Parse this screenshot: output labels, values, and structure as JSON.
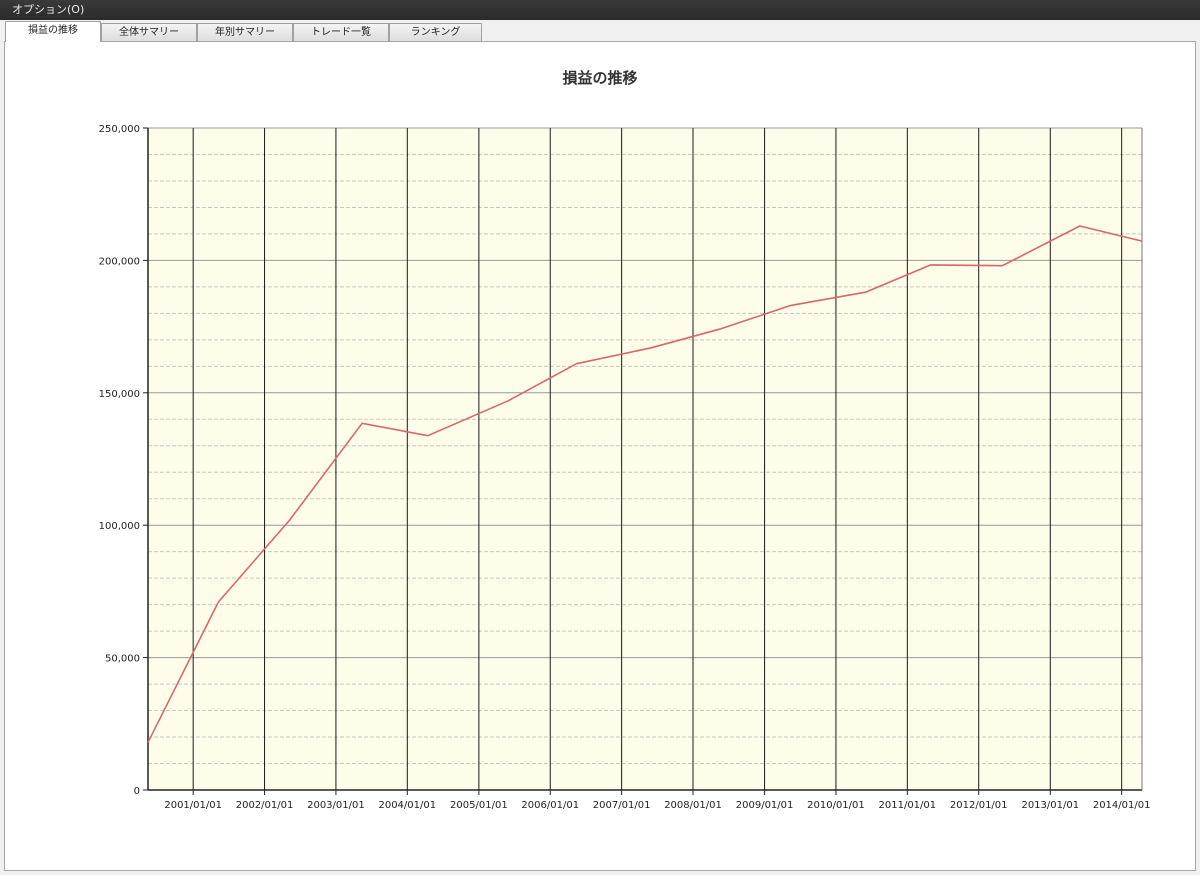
{
  "menubar": {
    "options_label": "オプション(O)"
  },
  "tabs": [
    {
      "label": "損益の推移",
      "active": true
    },
    {
      "label": "全体サマリー",
      "active": false
    },
    {
      "label": "年別サマリー",
      "active": false
    },
    {
      "label": "トレード一覧",
      "active": false
    },
    {
      "label": "ランキング",
      "active": false
    }
  ],
  "colors": {
    "plot_background": "#fdfdea",
    "major_grid": "#1a1a1a",
    "minor_grid": "#c8c8c0",
    "line": "#d8676a"
  },
  "chart_data": {
    "type": "line",
    "title": "損益の推移",
    "xlabel": "",
    "ylabel": "",
    "grid": true,
    "x_ticks": [
      "2001/01/01",
      "2002/01/01",
      "2003/01/01",
      "2004/01/01",
      "2005/01/01",
      "2006/01/01",
      "2007/01/01",
      "2008/01/01",
      "2009/01/01",
      "2010/01/01",
      "2011/01/01",
      "2012/01/01",
      "2013/01/01",
      "2014/01/01"
    ],
    "xlim": [
      "2000/05/15",
      "2014/04/15"
    ],
    "y_ticks": [
      "0",
      "50,000",
      "100,000",
      "150,000",
      "200,000",
      "250,000"
    ],
    "ylim": [
      0,
      250000
    ],
    "series": [
      {
        "name": "",
        "x": [
          "2000/05/15",
          "2001/05/10",
          "2002/05/10",
          "2003/05/15",
          "2004/04/15",
          "2005/06/01",
          "2006/05/15",
          "2007/06/01",
          "2008/05/15",
          "2009/05/15",
          "2010/06/01",
          "2011/05/01",
          "2012/05/01",
          "2013/06/01",
          "2014/04/15"
        ],
        "y": [
          18000,
          71000,
          102000,
          138500,
          133800,
          147000,
          161000,
          167000,
          174000,
          183000,
          188000,
          198300,
          198000,
          213000,
          207300
        ]
      }
    ]
  }
}
